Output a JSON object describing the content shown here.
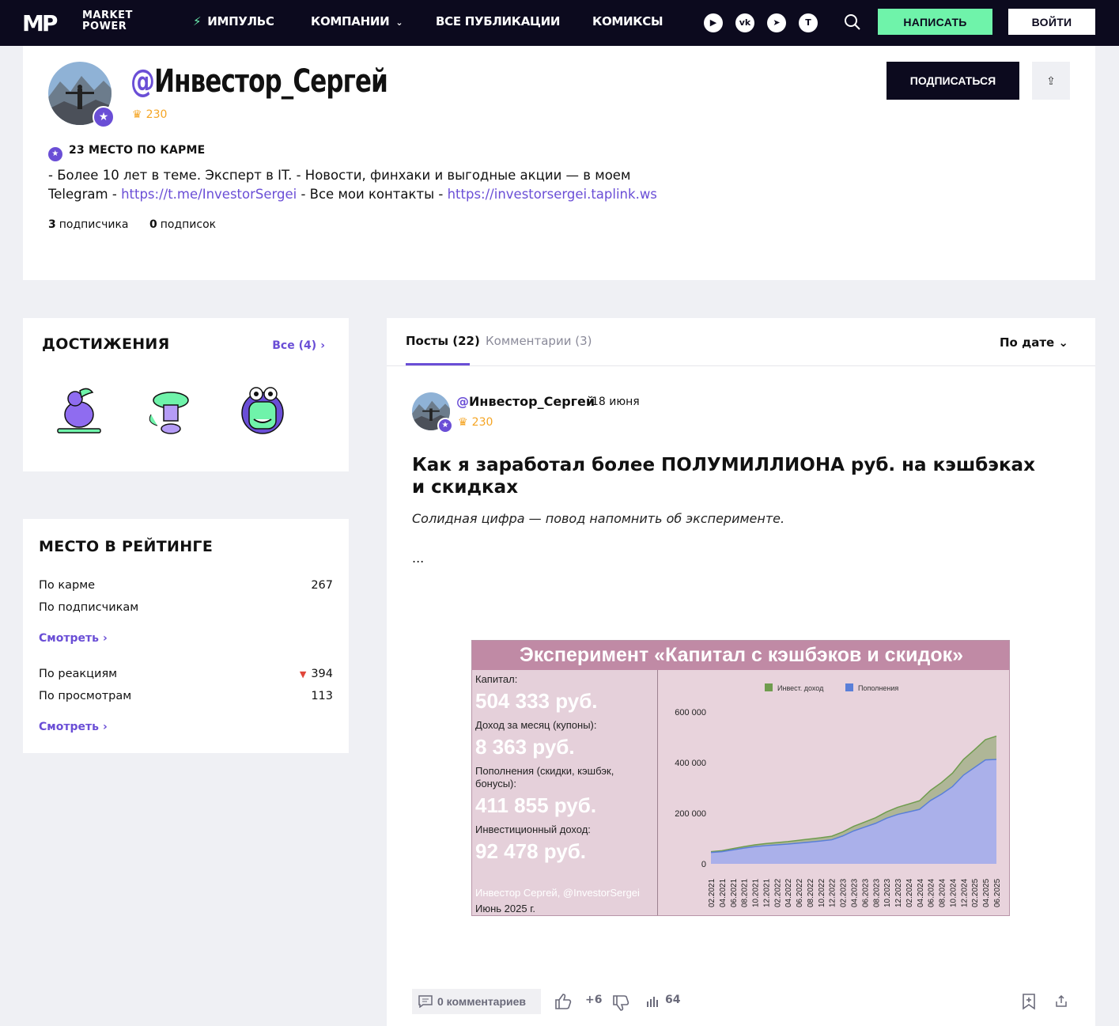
{
  "nav": {
    "logo_mark": "MP",
    "logo_line1": "MARKET",
    "logo_line2": "POWER",
    "items": [
      "ИМПУЛЬС",
      "КОМПАНИИ",
      "ВСЕ ПУБЛИКАЦИИ",
      "КОМИКСЫ"
    ],
    "socials": [
      "youtube-icon",
      "vk-icon",
      "telegram-icon",
      "tenchat-icon"
    ],
    "write": "НАПИСАТЬ",
    "login": "ВОЙТИ"
  },
  "profile": {
    "at": "@",
    "name": "Инвестор_Сергей",
    "karma": "230",
    "subscribe": "ПОДПИСАТЬСЯ",
    "karma_place": "23 место по карме",
    "bio_text1": "- Более 10 лет в теме. Эксперт в IT. - Новости, финхаки и выгодные акции — в моем",
    "bio_text2": "Telegram - ",
    "bio_link1": "https://t.me/InvestorSergei",
    "bio_text3": " - Все мои контакты - ",
    "bio_link2": "https://investorsergei.taplink.ws",
    "subscribers_count": "3",
    "subscribers_label": "подписчика",
    "subscriptions_count": "0",
    "subscriptions_label": "подписок"
  },
  "achievements": {
    "title": "ДОСТИЖЕНИЯ",
    "all": "Все (4)"
  },
  "rating": {
    "title": "МЕСТО В РЕЙТИНГЕ",
    "rows1": [
      {
        "label": "По карме",
        "value": "267"
      },
      {
        "label": "По подписчикам",
        "value": ""
      }
    ],
    "more": "Смотреть",
    "rows2": [
      {
        "label": "По реакциям",
        "value": "394"
      },
      {
        "label": "По просмотрам",
        "value": "113"
      }
    ]
  },
  "feed": {
    "tab_posts": "Посты (22)",
    "tab_comments": "Комментарии (3)",
    "sort": "По дате"
  },
  "post": {
    "author": "@Инвестор_Сергей",
    "date": "18 июня",
    "karma": "230",
    "title": "Как я заработал более ПОЛУМИЛЛИОНА руб. на кэшбэках и скидках",
    "lead": "Солидная цифра — повод напомнить об эксперименте.",
    "ellipsis": "...",
    "comments": "0 комментариев",
    "likes": "+6",
    "views": "64"
  },
  "figure": {
    "header": "Эксперимент «Капитал с кэшбэков и скидок»",
    "capital_label": "Капитал:",
    "capital_value": "504 333 руб.",
    "income_label": "Доход за месяц (купоны):",
    "income_value": "8 363 руб.",
    "topup_label": "Пополнения (скидки, кэшбэк, бонусы):",
    "topup_value": "411 855 руб.",
    "invest_label": "Инвестиционный доход:",
    "invest_value": "92 478 руб.",
    "credit": "Инвестор Сергей, @InvestorSergei",
    "date": "Июнь 2025 г."
  },
  "chart_data": {
    "type": "area",
    "x": [
      "02.2021",
      "04.2021",
      "06.2021",
      "08.2021",
      "10.2021",
      "12.2021",
      "02.2022",
      "04.2022",
      "06.2022",
      "08.2022",
      "10.2022",
      "12.2022",
      "02.2023",
      "04.2023",
      "06.2023",
      "08.2023",
      "10.2023",
      "12.2023",
      "02.2024",
      "04.2024",
      "06.2024",
      "08.2024",
      "10.2024",
      "12.2024",
      "02.2025",
      "04.2025",
      "06.2025"
    ],
    "series": [
      {
        "name": "Пополнения",
        "values": [
          45000,
          48000,
          55000,
          62000,
          68000,
          72000,
          75000,
          78000,
          82000,
          86000,
          90000,
          95000,
          110000,
          130000,
          145000,
          160000,
          180000,
          195000,
          205000,
          215000,
          250000,
          275000,
          305000,
          350000,
          380000,
          410000,
          412000
        ]
      },
      {
        "name": "Инвест. доход",
        "values": [
          3000,
          4000,
          5000,
          6000,
          7000,
          8000,
          9000,
          10000,
          11000,
          12000,
          13000,
          14000,
          16000,
          18000,
          20000,
          22000,
          25000,
          28000,
          31000,
          34000,
          40000,
          46000,
          53000,
          62000,
          70000,
          80000,
          92000
        ]
      }
    ],
    "stacked": true,
    "yticks": [
      "0",
      "200 000",
      "400 000",
      "600 000"
    ],
    "ylim": [
      0,
      640000
    ],
    "legend": "top",
    "colors": {
      "Инвест. доход": "#6f9c4e",
      "Пополнения": "#5a7fd8"
    }
  }
}
